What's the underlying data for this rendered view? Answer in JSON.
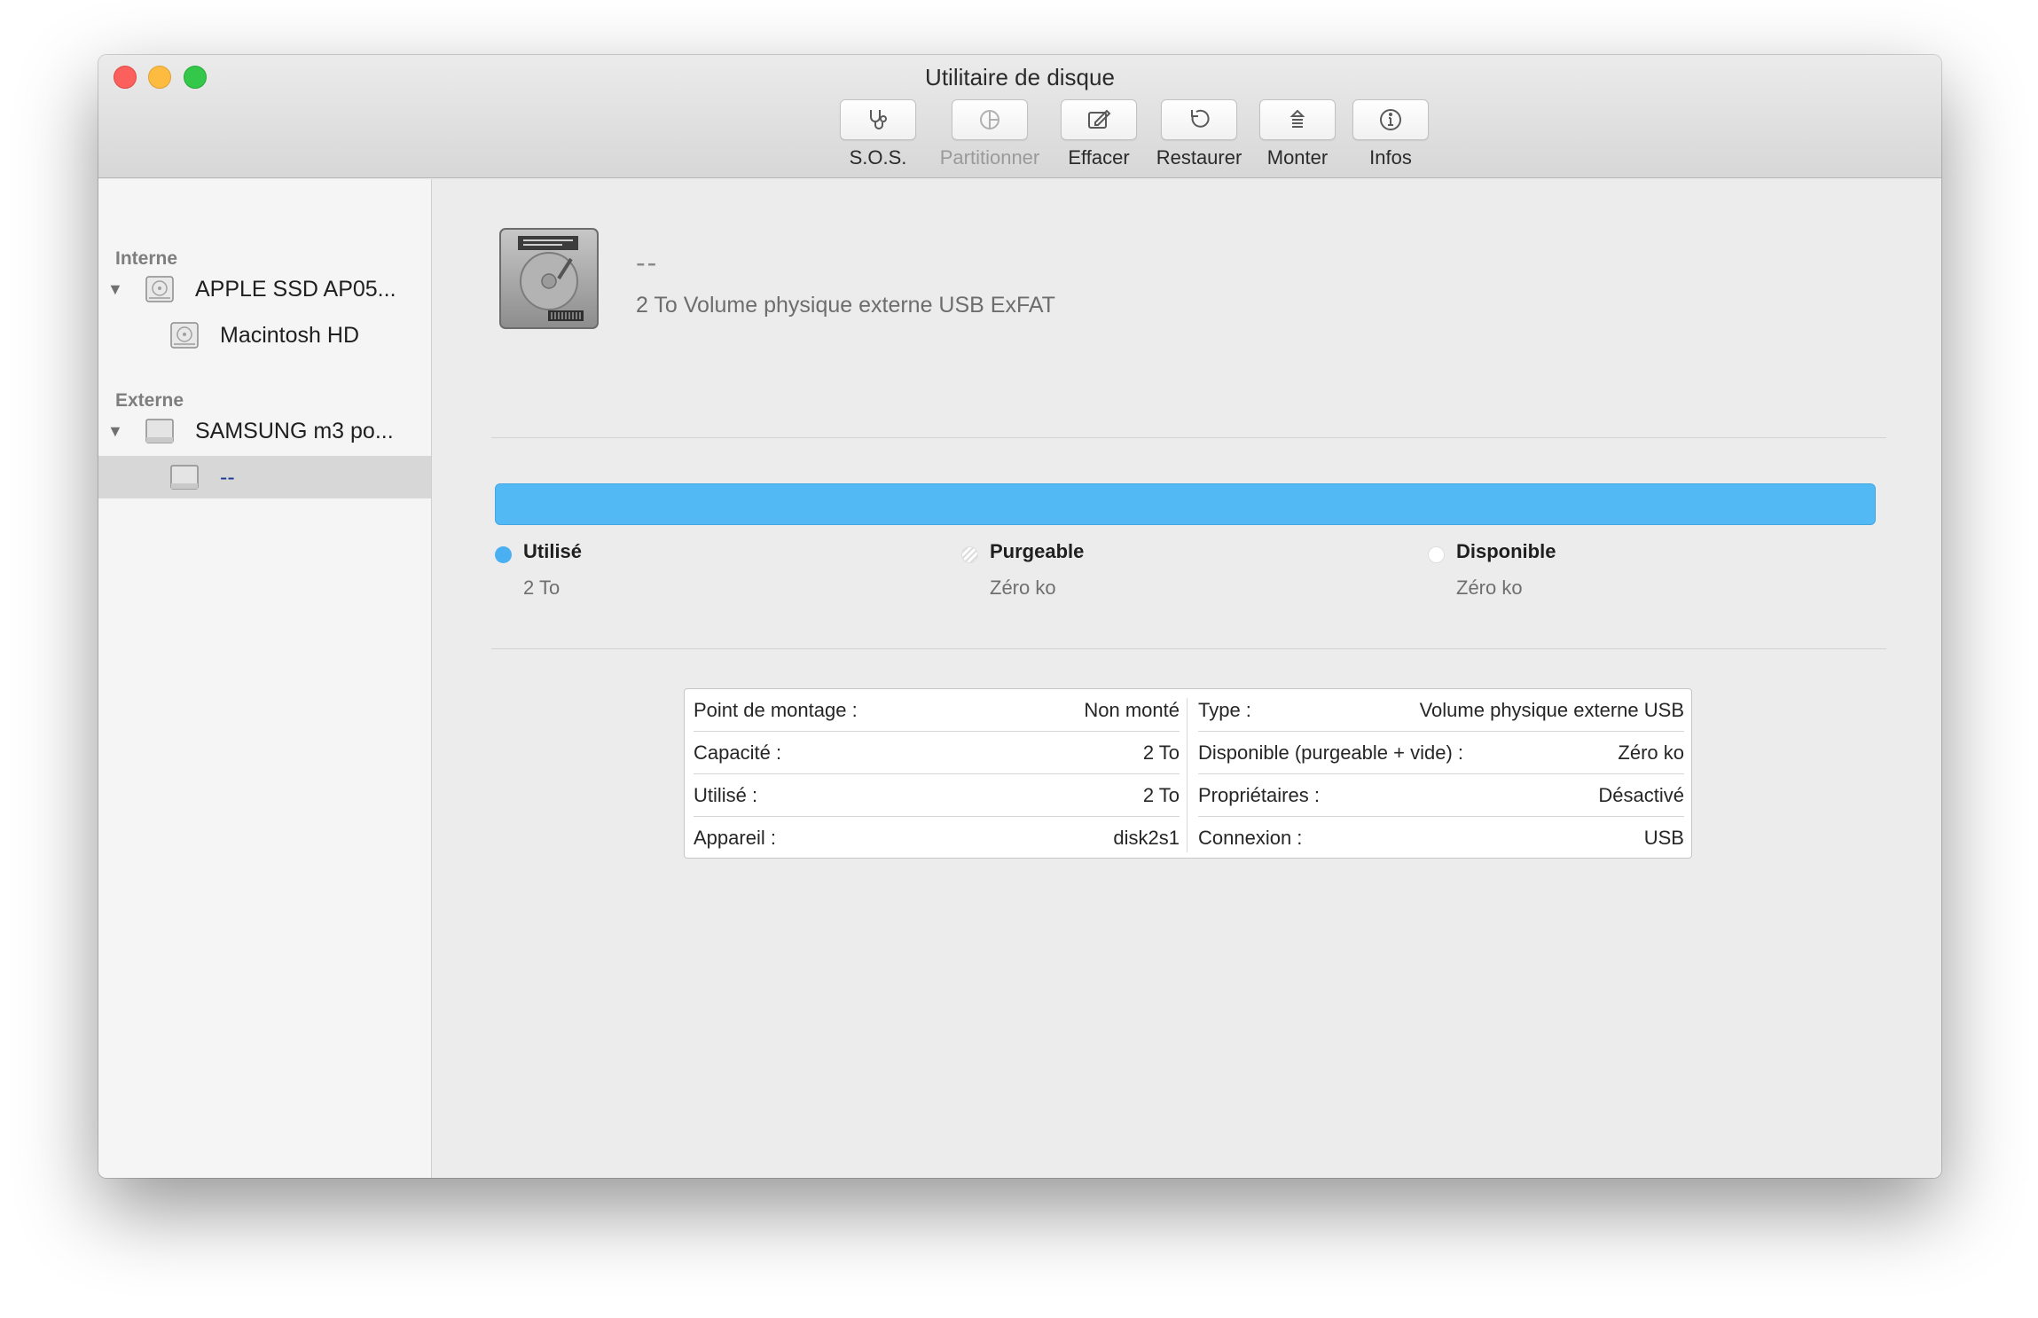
{
  "window": {
    "title": "Utilitaire de disque"
  },
  "toolbar": {
    "items": [
      {
        "label": "S.O.S.",
        "icon": "stethoscope-icon",
        "enabled": true
      },
      {
        "label": "Partitionner",
        "icon": "pie-chart-icon",
        "enabled": false
      },
      {
        "label": "Effacer",
        "icon": "erase-icon",
        "enabled": true
      },
      {
        "label": "Restaurer",
        "icon": "restore-icon",
        "enabled": true
      },
      {
        "label": "Monter",
        "icon": "mount-icon",
        "enabled": true
      },
      {
        "label": "Infos",
        "icon": "info-icon",
        "enabled": true
      }
    ]
  },
  "sidebar": {
    "sections": [
      {
        "header": "Interne",
        "items": [
          {
            "label": "APPLE SSD AP05...",
            "icon": "internal-disk-icon",
            "level": 0,
            "expanded": true,
            "selected": false
          },
          {
            "label": "Macintosh HD",
            "icon": "internal-volume-icon",
            "level": 1,
            "selected": false
          }
        ]
      },
      {
        "header": "Externe",
        "items": [
          {
            "label": "SAMSUNG m3 po...",
            "icon": "external-disk-icon",
            "level": 0,
            "expanded": true,
            "selected": false
          },
          {
            "label": "--",
            "icon": "external-volume-icon",
            "level": 1,
            "selected": true
          }
        ]
      }
    ]
  },
  "volume": {
    "name": "--",
    "description": "2 To Volume physique externe USB ExFAT",
    "icon": "hard-drive-icon"
  },
  "usage": {
    "used_fraction": 1.0,
    "bar_color": "#53b9f5",
    "legend": [
      {
        "label": "Utilisé",
        "value": "2 To",
        "color": "#4bb0f1"
      },
      {
        "label": "Purgeable",
        "value": "Zéro ko",
        "color": "#dcdcdc"
      },
      {
        "label": "Disponible",
        "value": "Zéro ko",
        "color": "#ffffff"
      }
    ]
  },
  "info": {
    "left": [
      {
        "key": "Point de montage :",
        "value": "Non monté"
      },
      {
        "key": "Capacité :",
        "value": "2 To"
      },
      {
        "key": "Utilisé :",
        "value": "2 To"
      },
      {
        "key": "Appareil :",
        "value": "disk2s1"
      }
    ],
    "right": [
      {
        "key": "Type :",
        "value": "Volume physique externe USB"
      },
      {
        "key": "Disponible (purgeable + vide) :",
        "value": "Zéro ko"
      },
      {
        "key": "Propriétaires :",
        "value": "Désactivé"
      },
      {
        "key": "Connexion :",
        "value": "USB"
      }
    ]
  }
}
